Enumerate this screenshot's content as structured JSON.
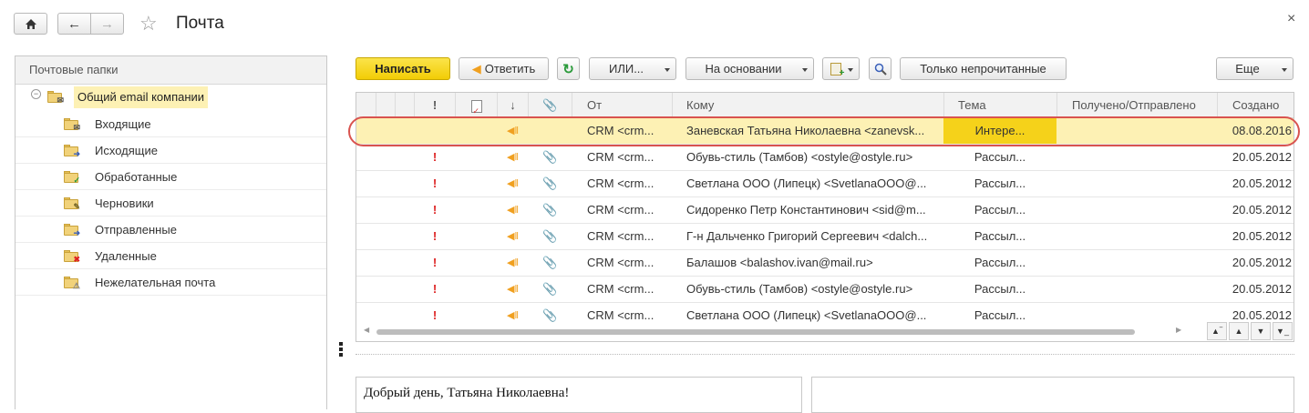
{
  "window": {
    "title": "Почта",
    "close": "×"
  },
  "toolbar": {
    "write": "Написать",
    "reply": "Ответить",
    "or": "ИЛИ...",
    "based_on": "На основании",
    "unread_only": "Только непрочитанные",
    "more": "Еще"
  },
  "folders": {
    "header": "Почтовые папки",
    "root": "Общий email компании",
    "items": [
      {
        "label": "Входящие",
        "icon": "inbox-folder-icon"
      },
      {
        "label": "Исходящие",
        "icon": "outbox-folder-icon"
      },
      {
        "label": "Обработанные",
        "icon": "processed-folder-icon"
      },
      {
        "label": "Черновики",
        "icon": "drafts-folder-icon"
      },
      {
        "label": "Отправленные",
        "icon": "sent-folder-icon"
      },
      {
        "label": "Удаленные",
        "icon": "deleted-folder-icon"
      },
      {
        "label": "Нежелательная почта",
        "icon": "spam-folder-icon"
      }
    ]
  },
  "table": {
    "columns": {
      "from": "От",
      "to": "Кому",
      "subject": "Тема",
      "received": "Получено/Отправлено",
      "created": "Создано"
    },
    "rows": [
      {
        "from": "CRM <crm...",
        "to": "Заневская Татьяна Николаевна <zanevsk...",
        "subject": "Интере...",
        "received": "",
        "created": "08.08.2016",
        "selected": true,
        "important": false,
        "attachment": false
      },
      {
        "from": "CRM <crm...",
        "to": "Обувь-стиль (Тамбов) <ostyle@ostyle.ru>",
        "subject": "Рассыл...",
        "received": "",
        "created": "20.05.2012",
        "selected": false,
        "important": true,
        "attachment": true
      },
      {
        "from": "CRM <crm...",
        "to": "Светлана ООО (Липецк) <SvetlanaOOO@...",
        "subject": "Рассыл...",
        "received": "",
        "created": "20.05.2012",
        "selected": false,
        "important": true,
        "attachment": true
      },
      {
        "from": "CRM <crm...",
        "to": "Сидоренко Петр Константинович <sid@m...",
        "subject": "Рассыл...",
        "received": "",
        "created": "20.05.2012",
        "selected": false,
        "important": true,
        "attachment": true
      },
      {
        "from": "CRM <crm...",
        "to": "Г-н Дальченко Григорий Сергеевич <dalch...",
        "subject": "Рассыл...",
        "received": "",
        "created": "20.05.2012",
        "selected": false,
        "important": true,
        "attachment": true
      },
      {
        "from": "CRM <crm...",
        "to": "Балашов <balashov.ivan@mail.ru>",
        "subject": "Рассыл...",
        "received": "",
        "created": "20.05.2012",
        "selected": false,
        "important": true,
        "attachment": true
      },
      {
        "from": "CRM <crm...",
        "to": "Обувь-стиль (Тамбов) <ostyle@ostyle.ru>",
        "subject": "Рассыл...",
        "received": "",
        "created": "20.05.2012",
        "selected": false,
        "important": true,
        "attachment": true
      },
      {
        "from": "CRM <crm...",
        "to": "Светлана ООО (Липецк) <SvetlanaOOO@...",
        "subject": "Рассыл...",
        "received": "",
        "created": "20.05.2012",
        "selected": false,
        "important": true,
        "attachment": true
      }
    ]
  },
  "preview": {
    "text": "Добрый день, Татьяна Николаевна!"
  },
  "colors": {
    "accent": "#f5d21a",
    "selection": "#fdf1b4",
    "highlight_ring": "#d9534f",
    "important": "#dd2222"
  }
}
